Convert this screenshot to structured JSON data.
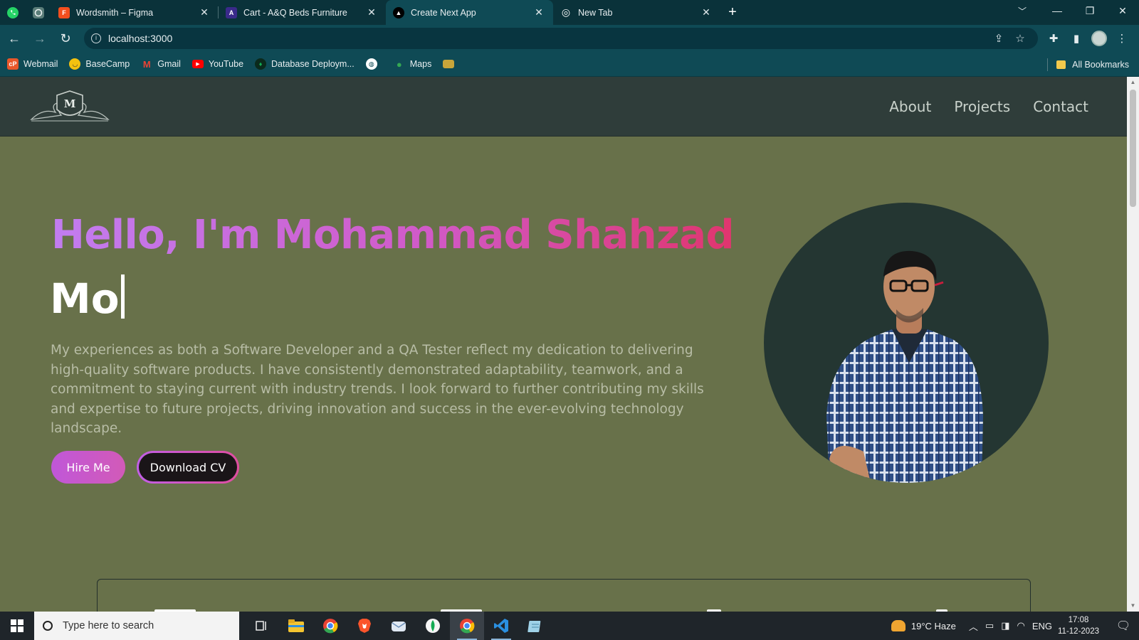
{
  "browser": {
    "tabs": [
      {
        "title": "Wordsmith – Figma",
        "color": "#f24e1e",
        "glyph": "F"
      },
      {
        "title": "Cart - A&Q Beds Furniture",
        "color": "#3a2a8a",
        "glyph": "A"
      },
      {
        "title": "Create Next App",
        "color": "#000000",
        "glyph": "▲"
      },
      {
        "title": "New Tab",
        "color": "#5f6368",
        "glyph": "◎"
      }
    ],
    "url": "localhost:3000",
    "bookmarks": [
      {
        "label": "Webmail",
        "color": "#e8572a"
      },
      {
        "label": "BaseCamp",
        "color": "#f4c10f"
      },
      {
        "label": "Gmail",
        "color": "#ea4335"
      },
      {
        "label": "YouTube",
        "color": "#ff0000"
      },
      {
        "label": "Database Deploym...",
        "color": "#13aa52"
      },
      {
        "label": "",
        "color": "#ffffff"
      },
      {
        "label": "Maps",
        "color": "#34a853"
      },
      {
        "label": "",
        "color": "#c8a53a"
      }
    ],
    "all_bookmarks": "All Bookmarks"
  },
  "site": {
    "logo_letter": "M",
    "nav": [
      "About",
      "Projects",
      "Contact"
    ],
    "hero": {
      "greeting": "Hello, I'm Mohammad Shahzad",
      "typed_text": "Mo",
      "bio": "My experiences as both a Software Developer and a QA Tester reflect my dedication to delivering high-quality software products. I have consistently demonstrated adaptability, teamwork, and a commitment to staying current with industry trends. I look forward to further contributing my skills and expertise to future projects, driving innovation and success in the ever-evolving technology landscape.",
      "hire_label": "Hire Me",
      "cv_label": "Download CV"
    }
  },
  "taskbar": {
    "search_placeholder": "Type here to search",
    "weather": "19°C  Haze",
    "lang": "ENG",
    "time": "17:08",
    "date": "11-12-2023"
  }
}
